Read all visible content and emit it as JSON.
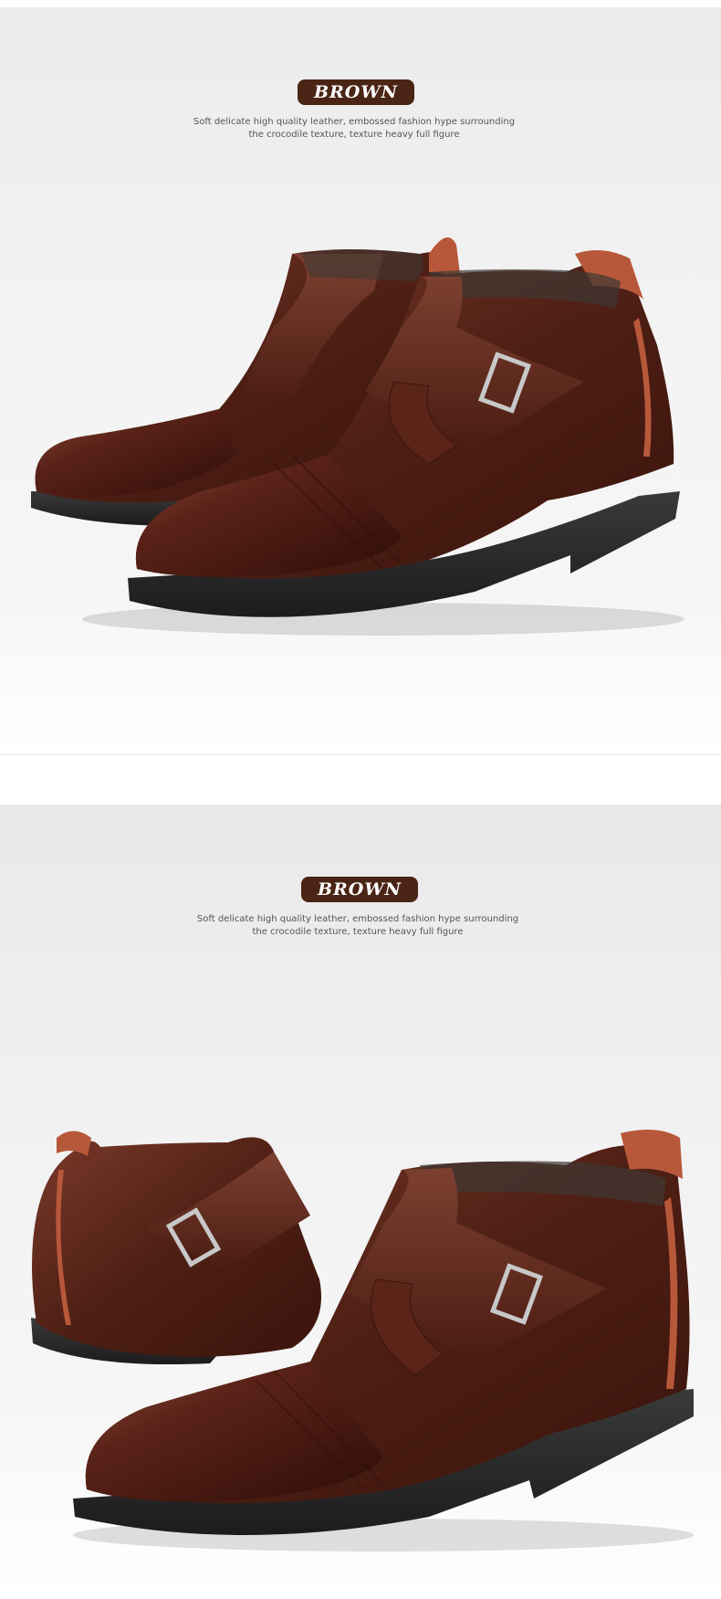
{
  "sections": [
    {
      "tag": "BROWN",
      "description": {
        "line1": "Soft delicate high quality leather, embossed fashion hype surrounding",
        "line2": "the crocodile texture, texture heavy full figure"
      },
      "image": "brown-leather-velcro-ankle-boots-pair"
    },
    {
      "tag": "BROWN",
      "description": {
        "line1": "Soft delicate high quality leather, embossed fashion hype surrounding",
        "line2": "the crocodile texture, texture heavy full figure"
      },
      "image": "brown-leather-velcro-ankle-boots-pair"
    }
  ],
  "colors": {
    "tag_background": "#4a2414",
    "leather": "#5a2418",
    "sole": "#2a2a2a",
    "suede_accent": "#b8583a"
  }
}
